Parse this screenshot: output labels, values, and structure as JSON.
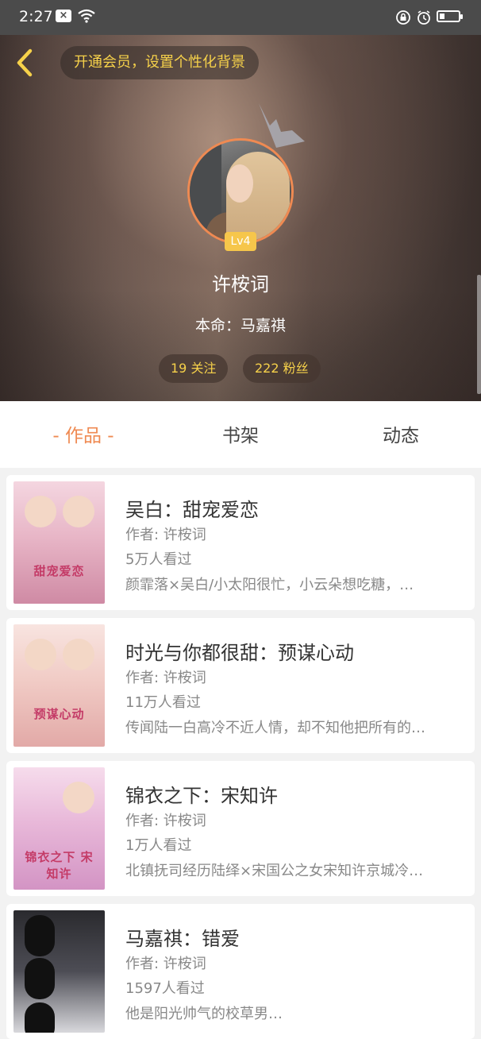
{
  "status_bar": {
    "time": "2:27"
  },
  "header": {
    "vip_prompt": "开通会员，设置个性化背景",
    "level_badge": "Lv4",
    "username": "许桉词",
    "bio": "本命：马嘉祺",
    "follow_label": "19 关注",
    "fans_label": "222 粉丝"
  },
  "tabs": [
    {
      "label": "- 作品 -",
      "active": true
    },
    {
      "label": "书架",
      "active": false
    },
    {
      "label": "动态",
      "active": false
    }
  ],
  "books": [
    {
      "title": "吴白：甜宠爱恋",
      "author": "作者: 许桉词",
      "views": "5万人看过",
      "desc": "颜霏落×吴白/小太阳很忙，小云朵想吃糖，…",
      "cover_text": "甜宠爱恋"
    },
    {
      "title": "时光与你都很甜：预谋心动",
      "author": "作者: 许桉词",
      "views": "11万人看过",
      "desc": "传闻陆一白高冷不近人情，却不知他把所有的…",
      "cover_text": "预谋心动"
    },
    {
      "title": "锦衣之下：宋知许",
      "author": "作者: 许桉词",
      "views": "1万人看过",
      "desc": "北镇抚司经历陆绎×宋国公之女宋知许京城冷…",
      "cover_text": "锦衣之下 宋知许"
    },
    {
      "title": "马嘉祺：错爱",
      "author": "作者: 许桉词",
      "views": "1597人看过",
      "desc": "他是阳光帅气的校草男…",
      "cover_text": ""
    }
  ],
  "colors": {
    "accent": "#ef8a52",
    "vip_text": "#f6d14a",
    "badge": "#f6c64b"
  }
}
